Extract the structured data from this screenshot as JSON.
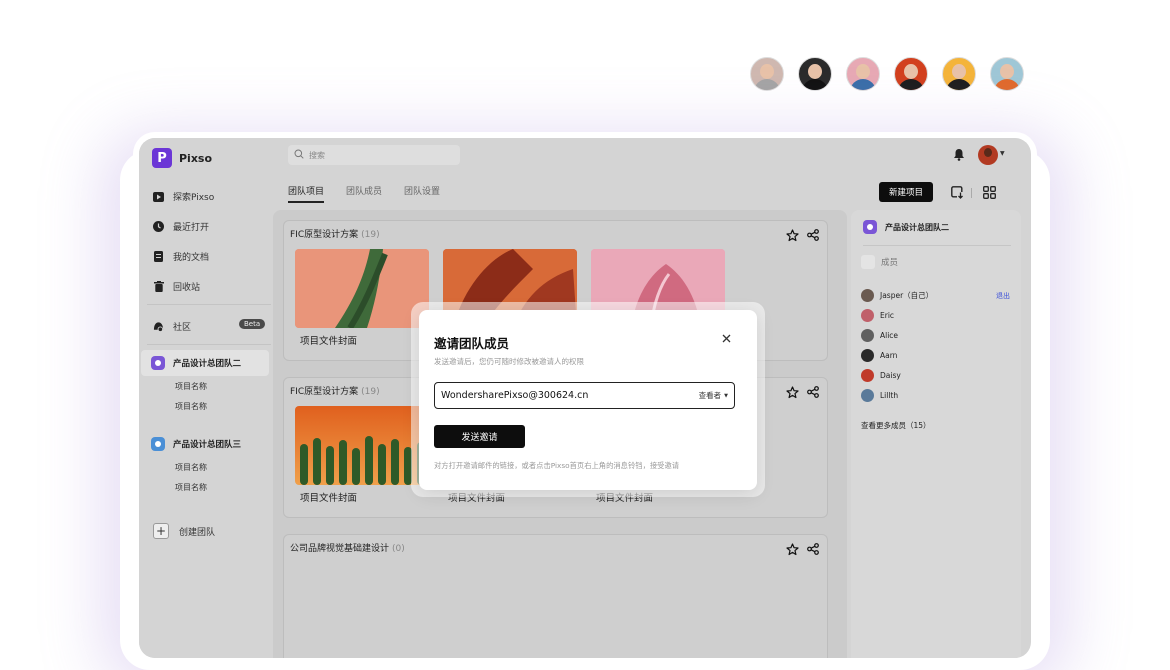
{
  "collaborators": [
    {
      "name": "collaborator-1",
      "bg": "#cfb8b0",
      "shirt": "#a4a4a4"
    },
    {
      "name": "collaborator-2",
      "bg": "#2b2b2b",
      "shirt": "#111111"
    },
    {
      "name": "collaborator-3",
      "bg": "#e7a9b4",
      "shirt": "#3a6ea8"
    },
    {
      "name": "collaborator-4",
      "bg": "#d2401e",
      "shirt": "#1d1d1d"
    },
    {
      "name": "collaborator-5",
      "bg": "#f4b43a",
      "shirt": "#1e1e1e"
    },
    {
      "name": "collaborator-6",
      "bg": "#9fc7d6",
      "shirt": "#e06a2c"
    }
  ],
  "app": {
    "name": "Pixso",
    "search_placeholder": "搜索"
  },
  "sidebar": {
    "nav": [
      {
        "label": "探索Pixso",
        "icon": "play-icon"
      },
      {
        "label": "最近打开",
        "icon": "clock-icon"
      },
      {
        "label": "我的文档",
        "icon": "document-icon"
      },
      {
        "label": "回收站",
        "icon": "trash-icon"
      }
    ],
    "community": {
      "label": "社区",
      "badge": "Beta"
    },
    "teams": [
      {
        "name": "产品设计总团队二",
        "color": "#7a56d6",
        "projects": [
          "项目名称",
          "项目名称"
        ]
      },
      {
        "name": "产品设计总团队三",
        "color": "#4a8fd6",
        "projects": [
          "项目名称",
          "项目名称"
        ]
      }
    ],
    "create_team": "创建团队"
  },
  "tabs": [
    "团队项目",
    "团队成员",
    "团队设置"
  ],
  "active_tab": "团队项目",
  "toolbar": {
    "new_project": "新建项目"
  },
  "projects": [
    {
      "title": "FIC原型设计方案",
      "count": "(19)",
      "labels": [
        "项目文件封面",
        "",
        ""
      ]
    },
    {
      "title": "FIC原型设计方案",
      "count": "(19)",
      "labels": [
        "项目文件封面",
        "项目文件封面",
        "项目文件封面"
      ]
    },
    {
      "title": "公司品牌视觉基础建设计",
      "count": "(0)",
      "labels": []
    }
  ],
  "right_panel": {
    "team_name": "产品设计总团队二",
    "members_label": "成员",
    "leave_label": "退出",
    "members": [
      {
        "name": "Jasper（自己）",
        "color": "#6a5a50"
      },
      {
        "name": "Eric",
        "color": "#c0606a"
      },
      {
        "name": "Alice",
        "color": "#606060"
      },
      {
        "name": "Aarn",
        "color": "#2a2a2a"
      },
      {
        "name": "Daisy",
        "color": "#c03a2a"
      },
      {
        "name": "Lillth",
        "color": "#5a7a9a"
      }
    ],
    "more_members": "查看更多成员（15）"
  },
  "modal": {
    "title": "邀请团队成员",
    "subtitle": "发送邀请后，您仍可随时修改被邀请人的权限",
    "email": "WondersharePixso@300624.cn",
    "role": "查看者",
    "send_label": "发送邀请",
    "hint": "对方打开邀请邮件的链接，或者点击Pixso首页右上角的消息铃铛，接受邀请"
  }
}
